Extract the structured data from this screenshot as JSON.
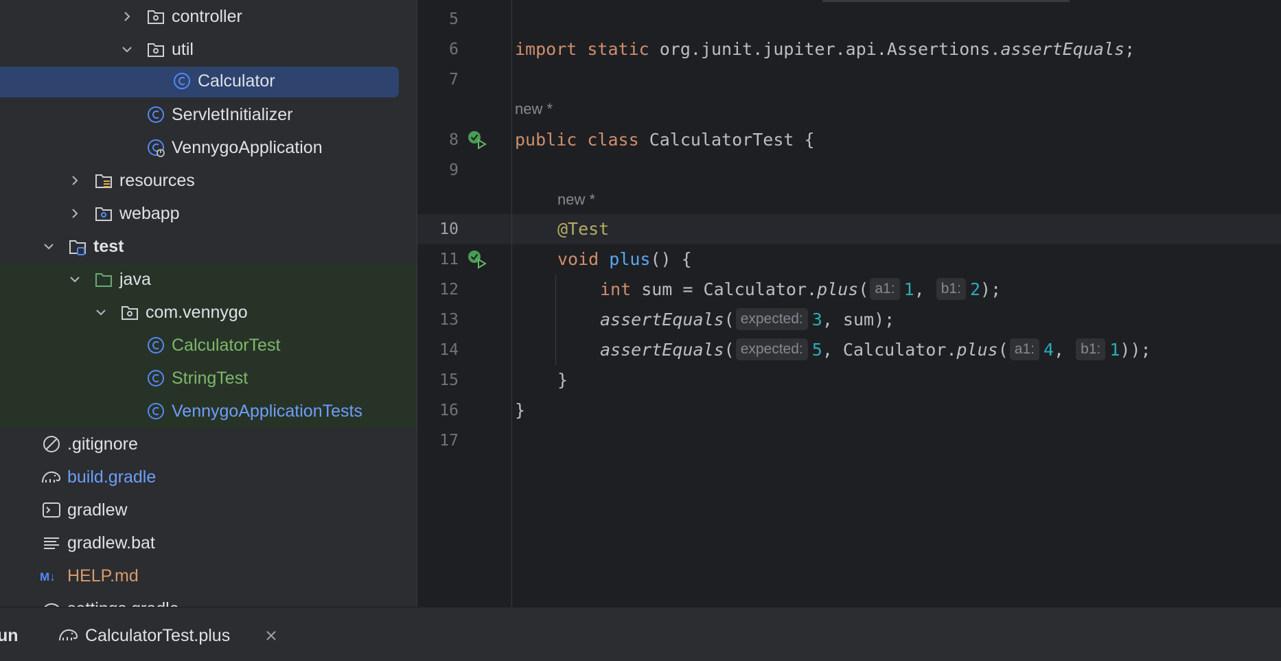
{
  "tree": {
    "items": [
      {
        "label": "controller",
        "icon": "package-folder-icon",
        "arrow": "right",
        "style": ""
      },
      {
        "label": "util",
        "icon": "package-folder-icon",
        "arrow": "down",
        "style": ""
      },
      {
        "label": "Calculator",
        "icon": "java-class-icon",
        "arrow": "",
        "style": "selected"
      },
      {
        "label": "ServletInitializer",
        "icon": "java-class-icon",
        "arrow": "",
        "style": ""
      },
      {
        "label": "VennygoApplication",
        "icon": "spring-boot-class-icon",
        "arrow": "",
        "style": ""
      },
      {
        "label": "resources",
        "icon": "resources-folder-icon",
        "arrow": "right",
        "style": ""
      },
      {
        "label": "webapp",
        "icon": "web-folder-icon",
        "arrow": "right",
        "style": ""
      },
      {
        "label": "test",
        "icon": "test-module-folder-icon",
        "arrow": "down",
        "style": "bold"
      },
      {
        "label": "java",
        "icon": "test-source-folder-icon",
        "arrow": "down",
        "style": "test-scope"
      },
      {
        "label": "com.vennygo",
        "icon": "package-folder-icon",
        "arrow": "down",
        "style": "test-scope"
      },
      {
        "label": "CalculatorTest",
        "icon": "java-class-icon",
        "arrow": "",
        "style": "test-scope green"
      },
      {
        "label": "StringTest",
        "icon": "java-class-icon",
        "arrow": "",
        "style": "test-scope green"
      },
      {
        "label": "VennygoApplicationTests",
        "icon": "java-class-icon",
        "arrow": "",
        "style": "test-scope blue"
      },
      {
        "label": ".gitignore",
        "icon": "ignore-file-icon",
        "arrow": "",
        "style": ""
      },
      {
        "label": "build.gradle",
        "icon": "gradle-elephant-icon",
        "arrow": "",
        "style": "blue"
      },
      {
        "label": "gradlew",
        "icon": "terminal-file-icon",
        "arrow": "",
        "style": ""
      },
      {
        "label": "gradlew.bat",
        "icon": "text-file-icon",
        "arrow": "",
        "style": ""
      },
      {
        "label": "HELP.md",
        "icon": "markdown-file-icon",
        "arrow": "",
        "style": "orange"
      },
      {
        "label": "settings.gradle",
        "icon": "gradle-elephant-icon",
        "arrow": "",
        "style": ""
      }
    ]
  },
  "editor": {
    "line_numbers": [
      "5",
      "6",
      "7",
      "8",
      "9",
      "10",
      "11",
      "12",
      "13",
      "14",
      "15",
      "16",
      "17"
    ],
    "current_line": "10",
    "codelens": {
      "class_author": "new *",
      "method_author": "new *"
    },
    "code": {
      "import_kw": "import",
      "static_kw": "static",
      "import_path": "org.junit.jupiter.api.Assertions.",
      "import_member": "assertEquals",
      "semicolon": ";",
      "public_kw": "public",
      "class_kw": "class",
      "class_name": "CalculatorTest {",
      "annotation": "@Test",
      "void_kw": "void",
      "method_name": "plus",
      "method_rest": "() {",
      "int_kw": "int",
      "sum_decl": " sum = Calculator.",
      "plus_call": "plus",
      "open_paren": "(",
      "hint_a1": "a1:",
      "hint_b1": "b1:",
      "hint_expected": "expected:",
      "val_1": "1",
      "val_2": "2",
      "val_3": "3",
      "val_4": "4",
      "val_5": "5",
      "comma_space": ", ",
      "close_stmt": ");",
      "close_stmt2": "));",
      "assert_call": "assertEquals",
      "sum_rest": ", sum);",
      "calc_ref": ", Calculator.",
      "close_brace": "}"
    }
  },
  "bottom": {
    "run_label": "un",
    "tab_label": "CalculatorTest.plus"
  },
  "colors": {
    "tree_bg": "#2b2d30",
    "editor_bg": "#1e1f22",
    "selection": "#2e436e",
    "test_scope_bg": "#283328",
    "keyword": "#cf8e6d",
    "function": "#56a8f5",
    "number": "#2aacb8",
    "annotation": "#b3ae60"
  }
}
